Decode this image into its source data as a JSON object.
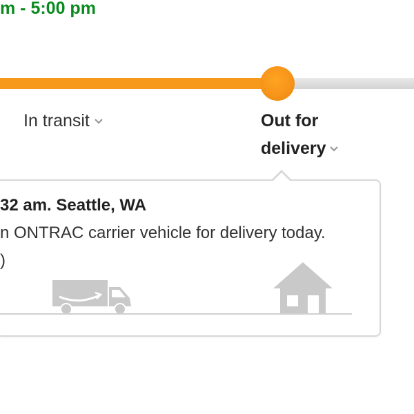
{
  "delivery_window": "m - 5:00 pm",
  "progress": {
    "fraction_complete": 0.67,
    "stages": [
      {
        "label": "In transit",
        "state": "complete",
        "chevron_icon": "chevron-down-icon"
      },
      {
        "label_line1": "Out for",
        "label_line2": "delivery",
        "state": "current",
        "chevron_icon": "chevron-down-icon"
      }
    ]
  },
  "event": {
    "headline": "32 am. Seattle, WA",
    "description": "n ONTRAC carrier vehicle for delivery today.",
    "extra": ")"
  },
  "illustration": {
    "truck_icon": "delivery-truck-icon",
    "house_icon": "house-icon"
  },
  "colors": {
    "eta_green": "#0a8a1f",
    "progress_orange": "#f79a1c",
    "track_gray": "#dddddd",
    "icon_gray": "#c9c9c9"
  }
}
